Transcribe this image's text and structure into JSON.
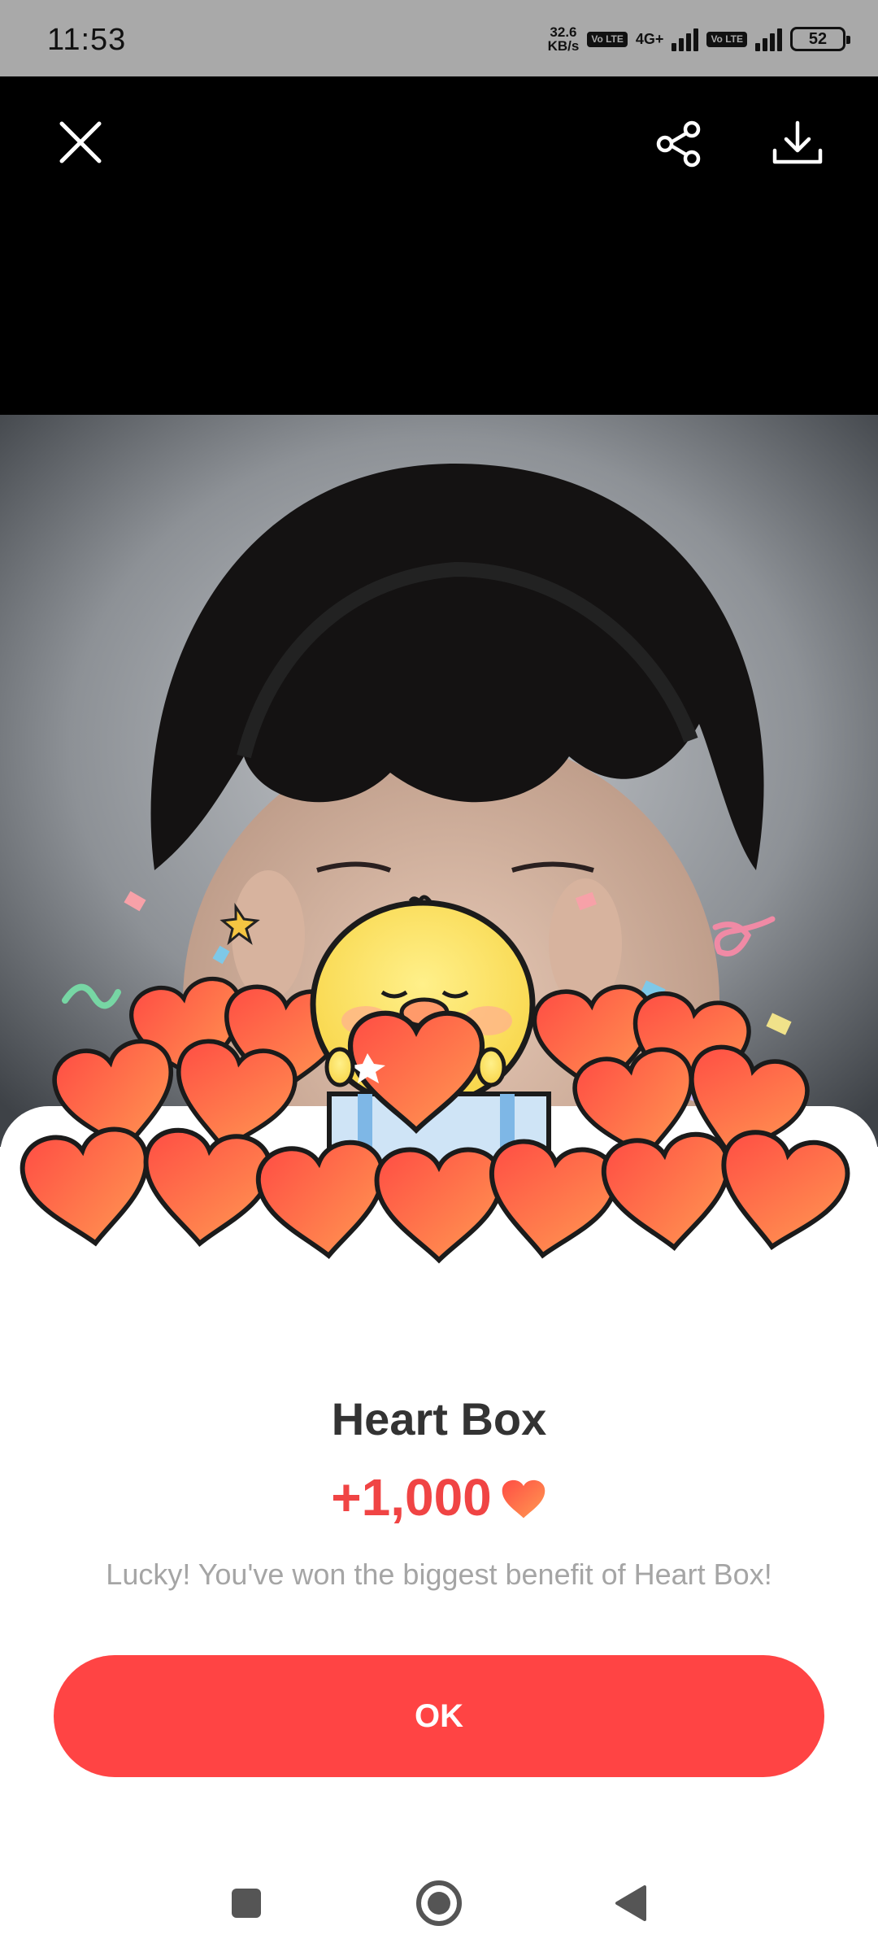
{
  "status_bar": {
    "time": "11:53",
    "net_speed_value": "32.6",
    "net_speed_unit": "KB/s",
    "volte_1": "Vo LTE",
    "net_type": "4G+",
    "volte_2": "Vo LTE",
    "battery": "52"
  },
  "toolbar": {
    "close_icon": "close-icon",
    "share_icon": "share-icon",
    "download_icon": "download-icon"
  },
  "popup": {
    "title": "Heart Box",
    "reward_amount": "+1,000",
    "reward_icon": "heart-icon",
    "description": "Lucky! You've won the biggest benefit of Heart Box!",
    "ok_label": "OK"
  },
  "nav_bar": {
    "recent_icon": "recent-apps-icon",
    "home_icon": "home-icon",
    "back_icon": "back-icon"
  },
  "colors": {
    "accent": "#ff4444",
    "title": "#333333",
    "description": "#a5a5a5",
    "status_bar_bg": "#a9a9a9"
  }
}
